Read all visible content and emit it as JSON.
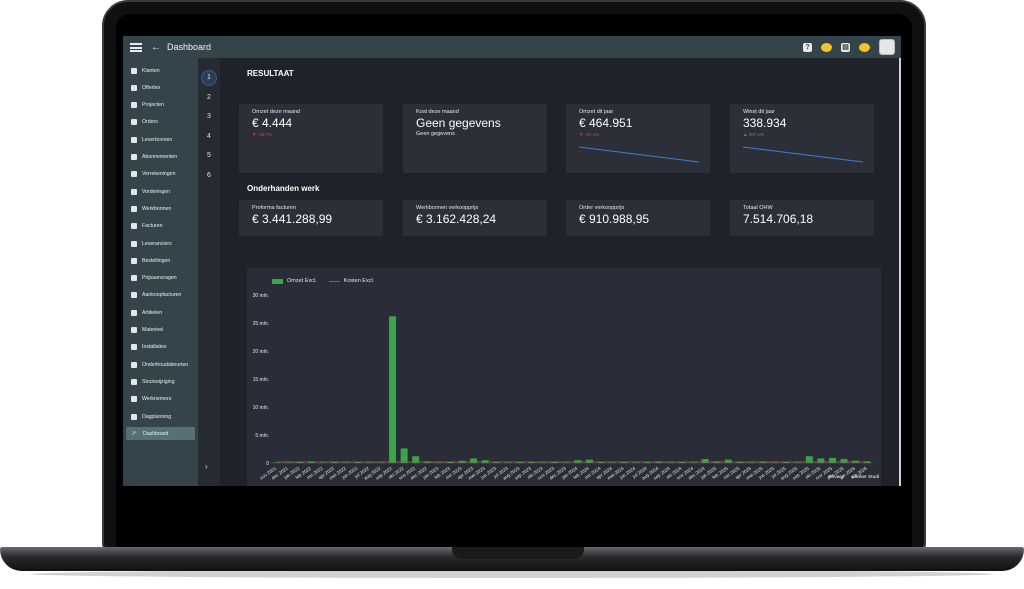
{
  "topbar": {
    "title": "Dashboard",
    "help_icon": "question-icon",
    "notification_icon": "chat-bubble-icon",
    "clipboard_icon": "clipboard-icon",
    "messages_icon": "chat-bubble-icon"
  },
  "sidebar": {
    "items": [
      {
        "label": "Klanten",
        "icon": "person-card-icon"
      },
      {
        "label": "Offertes",
        "icon": "document-icon"
      },
      {
        "label": "Projecten",
        "icon": "gear-icon"
      },
      {
        "label": "Orders",
        "icon": "list-icon"
      },
      {
        "label": "Leverbonnen",
        "icon": "truck-icon"
      },
      {
        "label": "Abonnementen",
        "icon": "refresh-icon"
      },
      {
        "label": "Verrekeningen",
        "icon": "calculator-icon"
      },
      {
        "label": "Vorderingen",
        "icon": "check-list-icon"
      },
      {
        "label": "Werkbonnen",
        "icon": "stopwatch-icon"
      },
      {
        "label": "Facturen",
        "icon": "euro-icon"
      },
      {
        "label": "Leveranciers",
        "icon": "person-card-icon"
      },
      {
        "label": "Bestellingen",
        "icon": "cart-icon"
      },
      {
        "label": "Prijsaanvragen",
        "icon": "tag-icon"
      },
      {
        "label": "Aankoopfacturen",
        "icon": "euro-icon"
      },
      {
        "label": "Artikelen",
        "icon": "box-icon"
      },
      {
        "label": "Materieel",
        "icon": "tools-icon"
      },
      {
        "label": "Installaties",
        "icon": "wrench-cross-icon"
      },
      {
        "label": "Onderhoudsbeurten",
        "icon": "wrench-icon"
      },
      {
        "label": "Stockwijziging",
        "icon": "swap-icon"
      },
      {
        "label": "Werknemers",
        "icon": "person-icon"
      },
      {
        "label": "Dagplanning",
        "icon": "grid-icon"
      },
      {
        "label": "Dashboard",
        "icon": "trend-icon"
      }
    ],
    "active": "Dashboard"
  },
  "steps": [
    "1",
    "2",
    "3",
    "4",
    "5",
    "6"
  ],
  "resultaat": {
    "title": "RESULTAAT",
    "cards": [
      {
        "label": "Omzet deze maand",
        "value": "€ 4.444",
        "sub": "",
        "delta": "▼ -98.7%",
        "delta_dir": "down"
      },
      {
        "label": "Kost deze maand",
        "value": "Geen gegevens",
        "sub": "Geen gegevens",
        "delta": "",
        "delta_dir": ""
      },
      {
        "label": "Omzet dit jaar",
        "value": "€ 464.951",
        "sub": "",
        "delta": "▼ -92.4%",
        "delta_dir": "down"
      },
      {
        "label": "Winst dit jaar",
        "value": "338.934",
        "sub": "",
        "delta": "▲ 107.1%",
        "delta_dir": "up"
      }
    ]
  },
  "ohw": {
    "title": "Onderhanden werk",
    "cards": [
      {
        "label": "Proforma facturen",
        "value": "€ 3.441.288,99"
      },
      {
        "label": "Werkbonnen verkoopprijs",
        "value": "€ 3.162.428,24"
      },
      {
        "label": "Order verkoopprijs",
        "value": "€ 910.988,95"
      },
      {
        "label": "Totaal OHW",
        "value": "7.514.706,18"
      }
    ]
  },
  "colors": {
    "bar": "#3aa64a",
    "line": "#d23f3f",
    "spark": "#3d7fd1"
  },
  "chart_data": {
    "type": "bar",
    "title": "",
    "xlabel": "",
    "ylabel": "",
    "ylim": [
      0,
      30
    ],
    "yticks": [
      "0",
      "5 mln.",
      "10 mln.",
      "15 mln.",
      "20 mln.",
      "25 mln.",
      "30 mln."
    ],
    "categories": [
      "nov 2021",
      "dec 2021",
      "jan 2022",
      "feb 2022",
      "mrt 2022",
      "apr 2022",
      "mei 2022",
      "jun 2022",
      "jul 2022",
      "aug 2022",
      "sep 2022",
      "okt 2022",
      "nov 2022",
      "dec 2022",
      "jan 2023",
      "feb 2023",
      "mrt 2023",
      "apr 2023",
      "mei 2023",
      "jun 2023",
      "jul 2023",
      "aug 2023",
      "sep 2023",
      "okt 2023",
      "nov 2023",
      "dec 2023",
      "jan 2024",
      "feb 2024",
      "mrt 2024",
      "apr 2024",
      "mei 2024",
      "jun 2024",
      "jul 2024",
      "aug 2024",
      "sep 2024",
      "okt 2024",
      "nov 2024",
      "dec 2024",
      "jan 2025",
      "feb 2025",
      "mrt 2025",
      "apr 2025",
      "mei 2025",
      "jun 2025",
      "jul 2025",
      "aug 2025",
      "sep 2025",
      "okt 2025",
      "nov 2025",
      "dec 2025",
      "jan 2026",
      "feb 2026"
    ],
    "series": [
      {
        "name": "Omzet Excl.",
        "type": "bar",
        "values": [
          0.1,
          0.1,
          0.2,
          0.3,
          0.1,
          0.2,
          0.1,
          0.2,
          0.1,
          0.1,
          26.2,
          2.6,
          1.2,
          0.3,
          0.1,
          0.2,
          0.4,
          0.8,
          0.5,
          0.2,
          0.1,
          0.2,
          0.2,
          0.1,
          0.2,
          0.1,
          0.5,
          0.6,
          0.2,
          0.1,
          0.2,
          0.1,
          0.2,
          0.3,
          0.1,
          0.2,
          0.1,
          0.7,
          0.3,
          0.6,
          0.2,
          0.1,
          0.3,
          0.1,
          0.2,
          0.1,
          1.2,
          0.8,
          0.9,
          0.7,
          0.4,
          0.3
        ]
      },
      {
        "name": "Kosten Excl.",
        "type": "line",
        "values": [
          0.2,
          0.2,
          0.2,
          0.2,
          0.2,
          0.2,
          0.2,
          0.2,
          0.2,
          0.2,
          0.2,
          0.2,
          0.2,
          0.2,
          0.2,
          0.2,
          0.2,
          0.2,
          0.2,
          0.2,
          0.2,
          0.2,
          0.2,
          0.2,
          0.2,
          0.2,
          0.2,
          0.2,
          0.2,
          0.2,
          0.2,
          0.2,
          0.2,
          0.2,
          0.2,
          0.2,
          0.2,
          0.2,
          0.2,
          0.2,
          0.2,
          0.2,
          0.2,
          0.2,
          0.2,
          0.2,
          0.2,
          0.2,
          0.2,
          0.2,
          0.2,
          0.2
        ]
      }
    ],
    "grid": false,
    "legend": "top-left"
  },
  "chart_footer": {
    "privacy": "Privacy",
    "looker": "Looker Studi"
  }
}
